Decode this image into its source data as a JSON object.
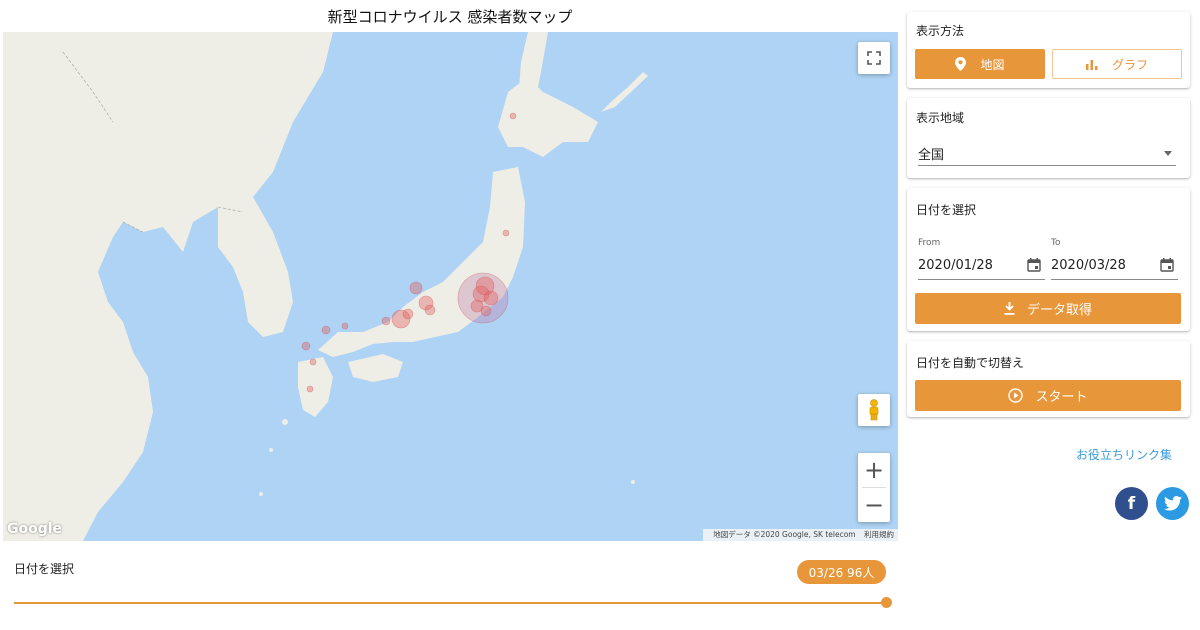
{
  "title": "新型コロナウイルス 感染者数マップ",
  "map": {
    "google_logo": "Google",
    "attribution": "地図データ ©2020 Google, SK telecom",
    "terms": "利用規約",
    "zoom_in": "+",
    "zoom_out": "−"
  },
  "timeline": {
    "label": "日付を選択",
    "badge": "03/26 96人",
    "progress_fraction": 1.0
  },
  "display_mode": {
    "title": "表示方法",
    "map_label": "地図",
    "graph_label": "グラフ",
    "selected": "map"
  },
  "region": {
    "title": "表示地域",
    "value": "全国"
  },
  "date_range": {
    "title": "日付を選択",
    "from_label": "From",
    "from_value": "2020/01/28",
    "to_label": "To",
    "to_value": "2020/03/28",
    "fetch_label": "データ取得"
  },
  "auto_switch": {
    "title": "日付を自動で切替え",
    "start_label": "スタート"
  },
  "links": {
    "useful_links": "お役立ちリンク集",
    "facebook": "f"
  },
  "colors": {
    "accent": "#e8963a",
    "sea": "#aed3f4",
    "land": "#eeeee6",
    "marker": "#e06060",
    "link": "#3a9ad9",
    "facebook": "#2f4f8f",
    "twitter": "#2b9ae2"
  }
}
